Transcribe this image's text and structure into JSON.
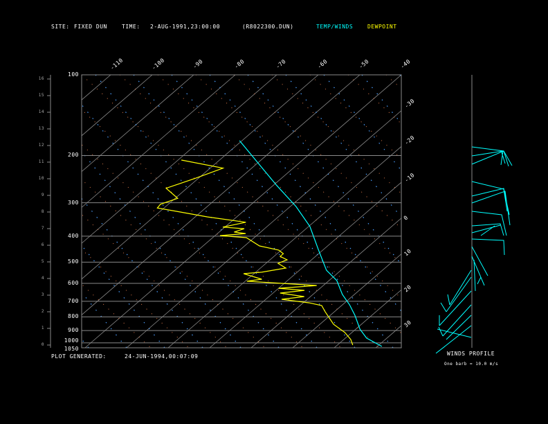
{
  "header": {
    "site_label": "SITE:",
    "site_value": "FIXED DUN",
    "time_label": "TIME:",
    "time_value": "2-AUG-1991,23:00:00",
    "file_name": "(R8022300.DUN)",
    "legend_temp": "TEMP/WINDS",
    "legend_dew": "DEWPOINT"
  },
  "footer": {
    "generated_label": "PLOT GENERATED:",
    "generated_value": "24-JUN-1994,00:07:09",
    "winds_title": "WINDS PROFILE",
    "barb_note": "One barb = 10.0 m/s"
  },
  "colors": {
    "temp": "#00ffff",
    "dew": "#ffff00",
    "grid": "#8a8a8a",
    "moist": "#4a9eff",
    "dry": "#e07a4a"
  },
  "chart_data": {
    "type": "line",
    "title": "Skew-T log-P sounding",
    "pressure_ticks": [
      "100",
      "200",
      "300",
      "400",
      "500",
      "600",
      "700",
      "800",
      "900",
      "1000",
      "1050"
    ],
    "pressure_values": [
      100,
      200,
      300,
      400,
      500,
      600,
      700,
      800,
      900,
      1000,
      1050
    ],
    "height_ticks_km": [
      "16",
      "15",
      "14",
      "13",
      "12",
      "11",
      "10",
      "9",
      "8",
      "7",
      "6",
      "5",
      "4",
      "3",
      "2",
      "1",
      "0"
    ],
    "top_temp_ticks": [
      "-110",
      "-100",
      "-90",
      "-80",
      "-70",
      "-60",
      "-50",
      "-40"
    ],
    "right_temp_ticks": [
      "-30",
      "-20",
      "-10",
      "0",
      "10",
      "20",
      "30"
    ],
    "ylim_hPa": [
      100,
      1050
    ],
    "series": [
      {
        "name": "TEMP/WINDS",
        "points_p_T": [
          [
            176,
            -60.6
          ],
          [
            216,
            -49.2
          ],
          [
            258,
            -39.3
          ],
          [
            310,
            -28.6
          ],
          [
            368,
            -19.7
          ],
          [
            448,
            -11.3
          ],
          [
            536,
            -3.5
          ],
          [
            586,
            1.9
          ],
          [
            660,
            7.1
          ],
          [
            721,
            11.7
          ],
          [
            789,
            15.9
          ],
          [
            889,
            21.0
          ],
          [
            960,
            25.1
          ],
          [
            1031,
            31.1
          ]
        ]
      },
      {
        "name": "DEWPOINT",
        "points_p_T": [
          [
            208,
            -69.2
          ],
          [
            223,
            -56.9
          ],
          [
            243,
            -60.7
          ],
          [
            265,
            -65.0
          ],
          [
            289,
            -59.4
          ],
          [
            304,
            -61.9
          ],
          [
            314,
            -61.6
          ],
          [
            323,
            -56.1
          ],
          [
            339,
            -47.0
          ],
          [
            355,
            -36.3
          ],
          [
            370,
            -40.5
          ],
          [
            375,
            -34.9
          ],
          [
            386,
            -36.4
          ],
          [
            391,
            -33.2
          ],
          [
            398,
            -38.8
          ],
          [
            405,
            -31.9
          ],
          [
            435,
            -26.4
          ],
          [
            451,
            -20.6
          ],
          [
            465,
            -18.5
          ],
          [
            476,
            -18.5
          ],
          [
            490,
            -15.9
          ],
          [
            505,
            -17.1
          ],
          [
            526,
            -13.9
          ],
          [
            545,
            -18.6
          ],
          [
            552,
            -22.5
          ],
          [
            579,
            -16.6
          ],
          [
            589,
            -19.6
          ],
          [
            611,
            -1.6
          ],
          [
            626,
            -10.0
          ],
          [
            637,
            -3.2
          ],
          [
            652,
            -8.3
          ],
          [
            672,
            -1.5
          ],
          [
            688,
            -6.2
          ],
          [
            709,
            1.4
          ],
          [
            726,
            5.2
          ],
          [
            766,
            7.8
          ],
          [
            853,
            13.3
          ],
          [
            915,
            18.3
          ],
          [
            972,
            21.7
          ],
          [
            1019,
            23.7
          ]
        ]
      }
    ]
  }
}
